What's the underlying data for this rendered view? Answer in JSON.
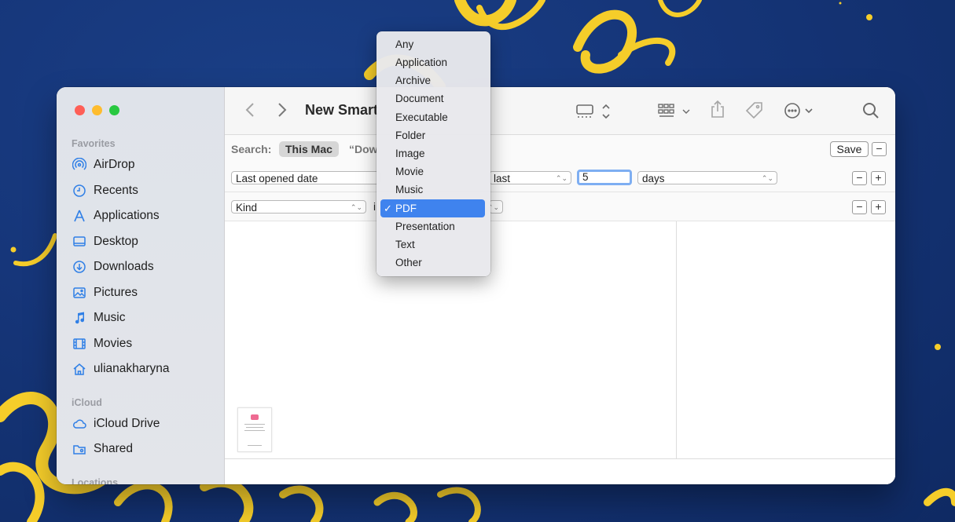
{
  "window": {
    "title": "New Smart",
    "traffic_lights": [
      "close",
      "minimize",
      "zoom"
    ]
  },
  "sidebar": {
    "favorites_label": "Favorites",
    "favorites": [
      {
        "label": "AirDrop",
        "icon": "airdrop-icon"
      },
      {
        "label": "Recents",
        "icon": "clock-icon"
      },
      {
        "label": "Applications",
        "icon": "applications-icon"
      },
      {
        "label": "Desktop",
        "icon": "desktop-icon"
      },
      {
        "label": "Downloads",
        "icon": "downloads-icon"
      },
      {
        "label": "Pictures",
        "icon": "pictures-icon"
      },
      {
        "label": "Music",
        "icon": "music-note-icon"
      },
      {
        "label": "Movies",
        "icon": "film-icon"
      },
      {
        "label": "ulianakharyna",
        "icon": "home-icon"
      }
    ],
    "icloud_label": "iCloud",
    "icloud": [
      {
        "label": "iCloud Drive",
        "icon": "cloud-icon"
      },
      {
        "label": "Shared",
        "icon": "shared-folder-icon"
      }
    ],
    "locations_label": "Locations"
  },
  "toolbar": {
    "icons": [
      "back-icon",
      "forward-icon",
      "view-icon",
      "group-icon",
      "share-icon",
      "tag-icon",
      "more-icon",
      "search-icon"
    ]
  },
  "search": {
    "label": "Search:",
    "scope_selected": "This Mac",
    "scope_other": "“Dow",
    "save_label": "Save",
    "minus": "−",
    "plus": "+"
  },
  "rules": [
    {
      "attribute": "Last opened date",
      "operator": "last",
      "value": "5",
      "unit": "days"
    },
    {
      "attribute": "Kind",
      "operator_fragment": "i"
    }
  ],
  "kind_menu": {
    "items": [
      "Any",
      "Application",
      "Archive",
      "Document",
      "Executable",
      "Folder",
      "Image",
      "Movie",
      "Music",
      "PDF",
      "Presentation",
      "Text",
      "Other"
    ],
    "selected": "PDF",
    "check": "✓"
  },
  "colors": {
    "accent": "#3f83ee",
    "wallpaper_blue": "#16367a",
    "ribbon_yellow": "#f5cd2a"
  }
}
